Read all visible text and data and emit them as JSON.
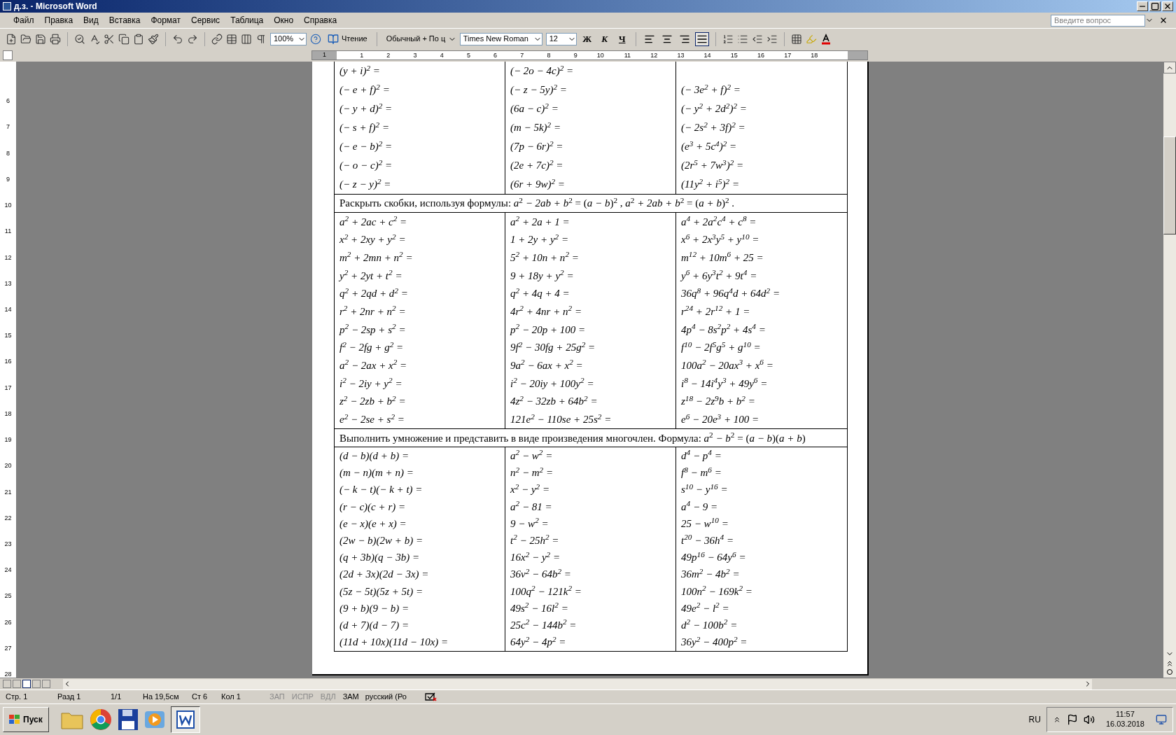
{
  "window": {
    "title": "д.з. - Microsoft Word"
  },
  "menu": [
    "Файл",
    "Правка",
    "Вид",
    "Вставка",
    "Формат",
    "Сервис",
    "Таблица",
    "Окно",
    "Справка"
  ],
  "help_field": {
    "placeholder": "Введите вопрос"
  },
  "toolbar": {
    "zoom": "100%",
    "reading": "Чтение",
    "style": "Обычный + По ц",
    "font": "Times New Roman",
    "size": "12",
    "bold": "Ж",
    "italic": "К",
    "underline": "Ч",
    "alignment_buttons": [
      {
        "selected": false
      },
      {
        "selected": false
      },
      {
        "selected": false
      },
      {
        "selected": true
      }
    ]
  },
  "ruler": {
    "start": "1",
    "marks": [
      "1",
      "2",
      "3",
      "4",
      "5",
      "6",
      "7",
      "8",
      "9",
      "10",
      "11",
      "12",
      "13",
      "14",
      "15",
      "16",
      "17",
      "18"
    ]
  },
  "vertical_ruler": [
    "6",
    "7",
    "8",
    "9",
    "10",
    "11",
    "12",
    "13",
    "14",
    "15",
    "16",
    "17",
    "18",
    "19",
    "20",
    "21",
    "22",
    "23",
    "24",
    "25",
    "26",
    "27",
    "28"
  ],
  "document": {
    "sections": [
      {
        "columns": [
          [
            "(y + i)$^{2}$ =",
            "(− e + f)$^{2}$ =",
            "(− y + d)$^{2}$ =",
            "(− s + f)$^{2}$ =",
            "(− e − b)$^{2}$ =",
            "(− o − c)$^{2}$ =",
            "(− z − y)$^{2}$ ="
          ],
          [
            "(− 2o − 4c)$^{2}$ =",
            "(− z − 5y)$^{2}$ =",
            "(6a − c)$^{2}$ =",
            "(m − 5k)$^{2}$ =",
            "(7p − 6r)$^{2}$ =",
            "(2e + 7c)$^{2}$ =",
            "(6r + 9w)$^{2}$ ="
          ],
          [
            "(− 3e$^{2}$ + f)$^{2}$ =",
            "(− y$^{2}$ + 2d$^{2}$)$^{2}$ =",
            "(− 2s$^{2}$ + 3f)$^{2}$ =",
            "(e$^{3}$ + 5c$^{4}$)$^{2}$ =",
            "(2r$^{5}$ + 7w$^{3}$)$^{2}$ =",
            "(11y$^{2}$ + i$^{5}$)$^{2}$ ="
          ]
        ]
      },
      {
        "header": "Раскрыть скобки, используя формулы:  *a*$^{2}$ *− 2ab + b*$^{2}$ = (*a − b*)$^{2}$ ,    *a*$^{2}$ *+ 2ab + b*$^{2}$ = (*a + b*)$^{2}$ .",
        "columns": [
          [
            "a$^{2}$ + 2ac + c$^{2}$ =",
            "x$^{2}$ + 2xy + y$^{2}$ =",
            "m$^{2}$ + 2mn + n$^{2}$ =",
            "y$^{2}$ + 2yt + t$^{2}$ =",
            "q$^{2}$ + 2qd + d$^{2}$ =",
            "r$^{2}$ + 2nr + n$^{2}$ =",
            "p$^{2}$ − 2sp + s$^{2}$ =",
            "f$^{2}$ − 2fg + g$^{2}$ =",
            "a$^{2}$ − 2ax + x$^{2}$ =",
            "i$^{2}$ − 2iy + y$^{2}$ =",
            "z$^{2}$ − 2zb + b$^{2}$ =",
            "e$^{2}$ − 2se + s$^{2}$ ="
          ],
          [
            "a$^{2}$ + 2a + 1 =",
            "1 + 2y + y$^{2}$ =",
            "5$^{2}$ + 10n + n$^{2}$ =",
            "9 + 18y + y$^{2}$ =",
            "q$^{2}$ + 4q + 4 =",
            "4r$^{2}$ + 4nr + n$^{2}$ =",
            "p$^{2}$ − 20p + 100 =",
            "9f$^{2}$ − 30fg + 25g$^{2}$ =",
            "9a$^{2}$ − 6ax + x$^{2}$ =",
            "i$^{2}$ − 20iy + 100y$^{2}$ =",
            "4z$^{2}$ − 32zb + 64b$^{2}$ =",
            "121e$^{2}$ − 110se + 25s$^{2}$ ="
          ],
          [
            "a$^{4}$ + 2a$^{2}$c$^{4}$ + c$^{8}$ =",
            "x$^{6}$ + 2x$^{3}$y$^{5}$ + y$^{10}$ =",
            "m$^{12}$ + 10m$^{6}$ + 25 =",
            "y$^{6}$ + 6y$^{3}$t$^{2}$ + 9t$^{4}$ =",
            "36q$^{8}$ + 96q$^{4}$d + 64d$^{2}$ =",
            "r$^{24}$ + 2r$^{12}$ + 1 =",
            "4p$^{4}$ − 8s$^{2}$p$^{2}$ + 4s$^{4}$ =",
            "f$^{10}$ − 2f$^{5}$g$^{5}$ + g$^{10}$ =",
            "100a$^{2}$ − 20ax$^{3}$ + x$^{6}$ =",
            "i$^{8}$ − 14i$^{4}$y$^{3}$ + 49y$^{6}$ =",
            "z$^{18}$ − 2z$^{9}$b + b$^{2}$ =",
            "e$^{6}$ − 20e$^{3}$ + 100 ="
          ]
        ]
      },
      {
        "header": "Выполнить умножение и представить в виде произведения многочлен. Формула: *a*$^{2}$ *− b*$^{2}$ = (*a − b*)(*a + b*)",
        "columns": [
          [
            "(d − b)(d + b) =",
            "(m − n)(m + n) =",
            "(− k − t)(− k + t) =",
            "(r − c)(c + r) =",
            "(e − x)(e + x) =",
            "(2w − b)(2w + b) =",
            "(q + 3b)(q − 3b) =",
            "(2d + 3x)(2d − 3x) =",
            "(5z − 5t)(5z + 5t) =",
            "(9 + b)(9 − b) =",
            "(d + 7)(d − 7) =",
            "(11d + 10x)(11d − 10x) ="
          ],
          [
            "a$^{2}$ − w$^{2}$ =",
            "n$^{2}$ − m$^{2}$ =",
            "x$^{2}$ − y$^{2}$ =",
            "a$^{2}$ − 81 =",
            "9 − w$^{2}$ =",
            "t$^{2}$ − 25h$^{2}$ =",
            "16x$^{2}$ − y$^{2}$ =",
            "36v$^{2}$ − 64b$^{2}$ =",
            "100q$^{2}$ − 121k$^{2}$ =",
            "49s$^{2}$ − 16l$^{2}$ =",
            "25c$^{2}$ − 144b$^{2}$ =",
            "64y$^{2}$ − 4p$^{2}$ ="
          ],
          [
            "d$^{4}$ − p$^{4}$ =",
            "f$^{8}$ − m$^{6}$ =",
            "s$^{10}$ − y$^{16}$ =",
            "a$^{4}$ − 9 =",
            "25 − w$^{10}$ =",
            "t$^{20}$ − 36h$^{4}$ =",
            "49p$^{16}$ − 64y$^{6}$ =",
            "36m$^{2}$ − 4b$^{2}$ =",
            "100n$^{2}$ − 169k$^{2}$ =",
            "49e$^{2}$ − l$^{2}$ =",
            "d$^{2}$ − 100b$^{2}$ =",
            "36y$^{2}$ − 400p$^{2}$ ="
          ]
        ]
      }
    ]
  },
  "status_bar": {
    "page": "Стр. 1",
    "section": "Разд 1",
    "pages": "1/1",
    "position": "На 19,5см",
    "line": "Ст 6",
    "column": "Кол 1",
    "modes": [
      {
        "label": "ЗАП",
        "on": false
      },
      {
        "label": "ИСПР",
        "on": false
      },
      {
        "label": "ВДЛ",
        "on": false
      },
      {
        "label": "ЗАМ",
        "on": true
      }
    ],
    "language": "русский (Ро"
  },
  "taskbar": {
    "start": "Пуск",
    "language": "RU",
    "time": "11:57",
    "date": "16.03.2018"
  }
}
